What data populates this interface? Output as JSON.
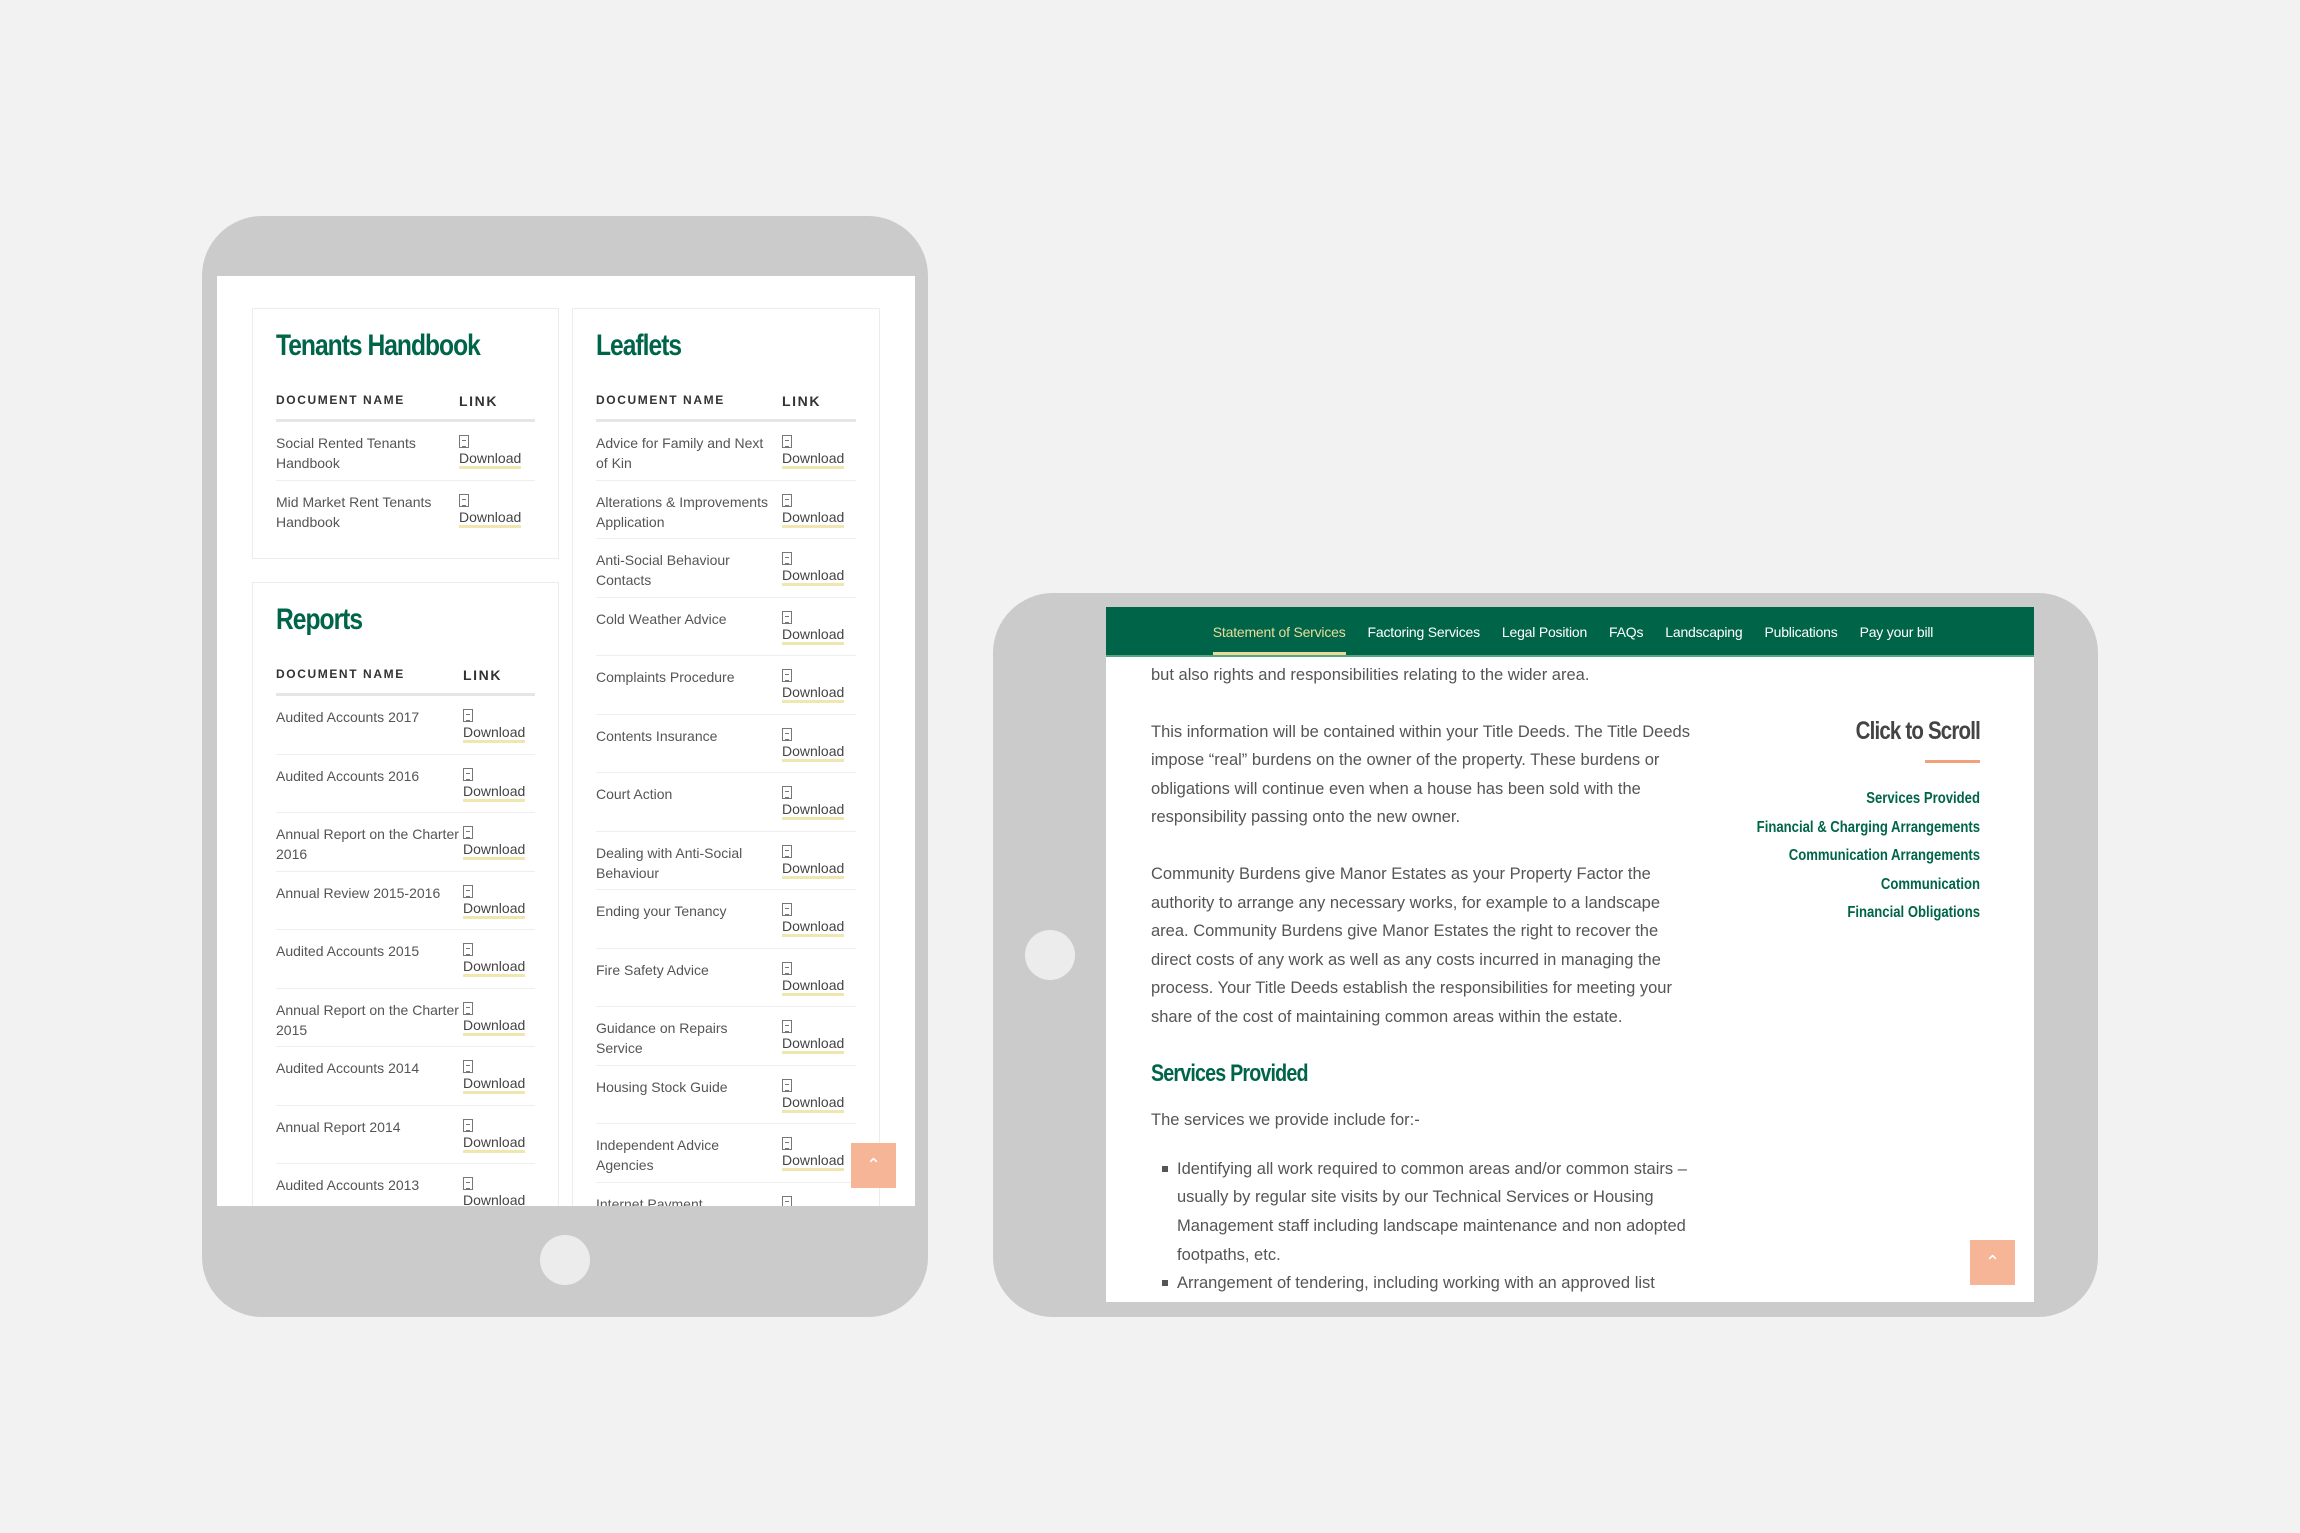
{
  "left_tablet": {
    "tenants_handbook": {
      "title": "Tenants Handbook",
      "col_name": "DOCUMENT NAME",
      "col_link": "LINK",
      "rows": [
        {
          "name": "Social Rented Tenants Handbook",
          "link": "Download"
        },
        {
          "name": "Mid Market Rent Tenants Handbook",
          "link": "Download"
        }
      ]
    },
    "reports": {
      "title": "Reports",
      "col_name": "DOCUMENT NAME",
      "col_link": "LINK",
      "rows": [
        {
          "name": "Audited Accounts 2017",
          "link": "Download"
        },
        {
          "name": "Audited Accounts 2016",
          "link": "Download"
        },
        {
          "name": "Annual Report on the Charter 2016",
          "link": "Download"
        },
        {
          "name": "Annual Review 2015-2016",
          "link": "Download"
        },
        {
          "name": "Audited Accounts 2015",
          "link": "Download"
        },
        {
          "name": "Annual Report on the Charter 2015",
          "link": "Download"
        },
        {
          "name": "Audited Accounts 2014",
          "link": "Download"
        },
        {
          "name": "Annual Report 2014",
          "link": "Download"
        },
        {
          "name": "Audited Accounts 2013",
          "link": "Download"
        }
      ]
    },
    "leaflets": {
      "title": "Leaflets",
      "col_name": "DOCUMENT NAME",
      "col_link": "LINK",
      "rows": [
        {
          "name": "Advice for Family and Next of Kin",
          "link": "Download"
        },
        {
          "name": "Alterations & Improvements Application",
          "link": "Download"
        },
        {
          "name": "Anti-Social Behaviour Contacts",
          "link": "Download"
        },
        {
          "name": "Cold Weather Advice",
          "link": "Download"
        },
        {
          "name": "Complaints Procedure",
          "link": "Download"
        },
        {
          "name": "Contents Insurance",
          "link": "Download"
        },
        {
          "name": "Court Action",
          "link": "Download"
        },
        {
          "name": "Dealing with Anti-Social Behaviour",
          "link": "Download"
        },
        {
          "name": "Ending your Tenancy",
          "link": "Download"
        },
        {
          "name": "Fire Safety Advice",
          "link": "Download"
        },
        {
          "name": "Guidance on Repairs Service",
          "link": "Download"
        },
        {
          "name": "Housing Stock Guide",
          "link": "Download"
        },
        {
          "name": "Independent Advice Agencies",
          "link": "Download"
        },
        {
          "name": "Internet Payment",
          "link": ""
        }
      ]
    },
    "to_top_icon": "chevron-up"
  },
  "right_tablet": {
    "nav": [
      "Statement of Services",
      "Factoring Services",
      "Legal Position",
      "FAQs",
      "Landscaping",
      "Publications",
      "Pay your bill"
    ],
    "nav_active": "Statement of Services",
    "content": {
      "p0": "but also rights and responsibilities relating to the wider area.",
      "p1": "This information will be contained within your Title Deeds. The Title Deeds impose “real” burdens on the owner of the property. These burdens or obligations will continue even when a house has been sold with the responsibility passing onto the new owner.",
      "p2": "Community Burdens give Manor Estates as your Property Factor the authority to arrange any necessary works, for example to a landscape area. Community Burdens give Manor Estates the right to recover the direct costs of any work as well as any costs incurred in managing the process. Your Title Deeds establish the responsibilities for meeting your share of the cost of maintaining common areas within the estate.",
      "heading": "Services Provided",
      "intro": "The services we provide include for:-",
      "bullets": [
        "Identifying all work required to common areas and/or common stairs – usually by regular site visits by our Technical Services or Housing Management staff including landscape maintenance and non adopted footpaths, etc.",
        "Arrangement of tendering, including working with an approved list"
      ]
    },
    "sidebar": {
      "title": "Click to Scroll",
      "links": [
        "Services Provided",
        "Financial & Charging Arrangements",
        "Communication Arrangements",
        "Communication",
        "Financial Obligations"
      ]
    }
  },
  "colors": {
    "brand_green": "#006548",
    "accent_orange": "#f7b598",
    "link_underline": "#efe6b0"
  }
}
